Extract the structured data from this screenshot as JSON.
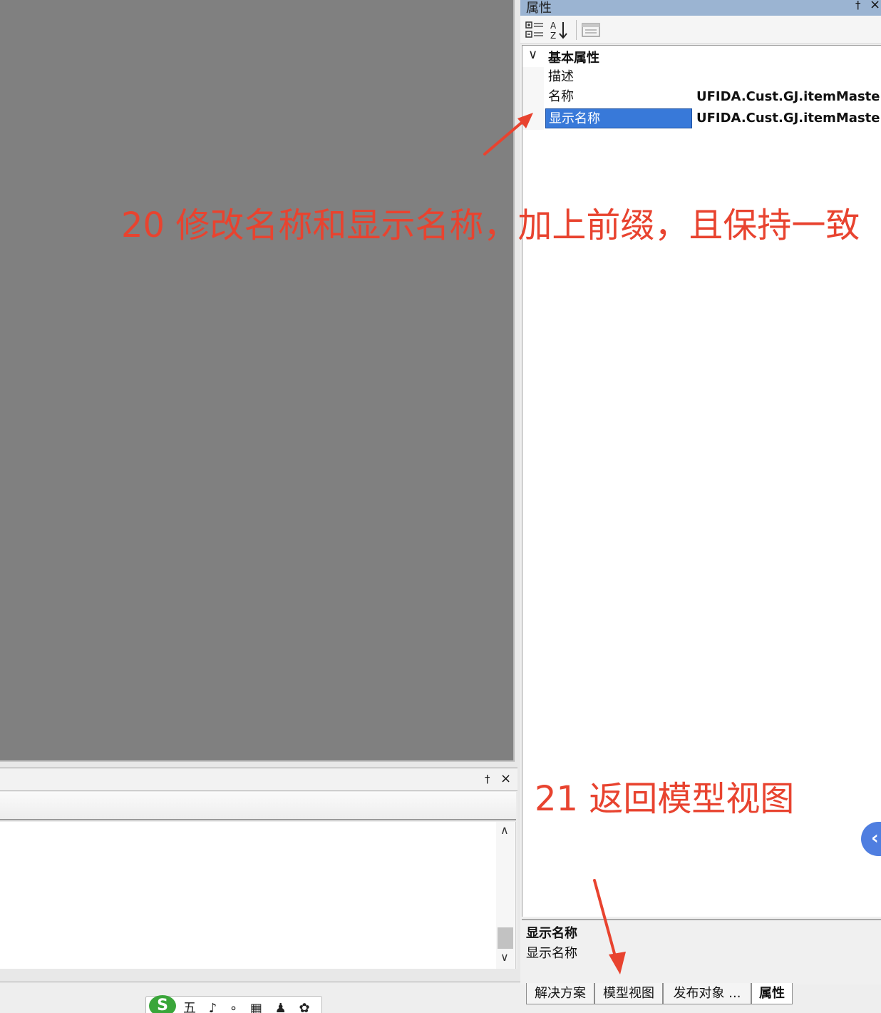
{
  "properties_panel": {
    "title": "属性",
    "pin_glyph": "†",
    "close_glyph": "×",
    "toolbar": {
      "categorized_icon": "categorized-icon",
      "alphabetical_icon": "sort-alphabetical-icon",
      "property_pages_icon": "property-pages-icon"
    },
    "category": {
      "expander": "∨",
      "label": "基本属性"
    },
    "rows": [
      {
        "name": "描述",
        "value": ""
      },
      {
        "name": "名称",
        "value": "UFIDA.Cust.GJ.itemMaster"
      },
      {
        "name": "显示名称",
        "value": "UFIDA.Cust.GJ.itemMaster"
      }
    ],
    "description": {
      "title": "显示名称",
      "text": "显示名称"
    }
  },
  "output_panel": {
    "pin_glyph": "†",
    "close_glyph": "×",
    "scroll_up": "∧",
    "scroll_down": "∨"
  },
  "bottom_tabs": [
    {
      "label": "解决方案"
    },
    {
      "label": "模型视图"
    },
    {
      "label": "发布对象 ..."
    },
    {
      "label": "属性"
    }
  ],
  "side_button_glyph": "‹",
  "ime": {
    "logo": "S",
    "glyphs": "五 ♪ ∘ ▦ ♟ ✿"
  },
  "annotations": {
    "step20": "20 修改名称和显示名称，加上前缀，且保持一致",
    "step21": "21 返回模型视图"
  },
  "colors": {
    "annotation": "#e8432f",
    "selection": "#3879d9",
    "titlebar": "#9bb4d2",
    "document_background": "#808080"
  }
}
